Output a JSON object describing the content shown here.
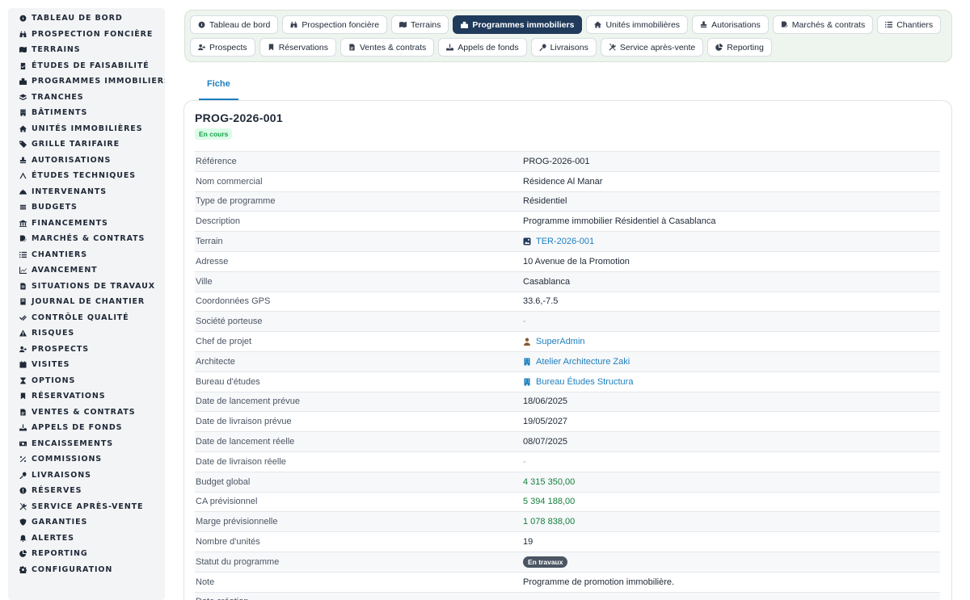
{
  "sidebar": {
    "items": [
      {
        "label": "Tableau de bord",
        "icon": "dashboard-icon"
      },
      {
        "label": "Prospection foncière",
        "icon": "binoculars-icon"
      },
      {
        "label": "Terrains",
        "icon": "map-icon"
      },
      {
        "label": "Études de faisabilité",
        "icon": "clipboard-check-icon"
      },
      {
        "label": "Programmes immobiliers",
        "icon": "city-icon"
      },
      {
        "label": "Tranches",
        "icon": "layers-icon"
      },
      {
        "label": "Bâtiments",
        "icon": "building-icon"
      },
      {
        "label": "Unités immobilières",
        "icon": "home-icon"
      },
      {
        "label": "Grille tarifaire",
        "icon": "tags-icon"
      },
      {
        "label": "Autorisations",
        "icon": "stamp-icon"
      },
      {
        "label": "Études techniques",
        "icon": "drafting-icon"
      },
      {
        "label": "Intervenants",
        "icon": "helmet-icon"
      },
      {
        "label": "Budgets",
        "icon": "coins-icon"
      },
      {
        "label": "Financements",
        "icon": "bank-icon"
      },
      {
        "label": "Marchés & contrats",
        "icon": "file-signature-icon"
      },
      {
        "label": "Chantiers",
        "icon": "list-icon"
      },
      {
        "label": "Avancement",
        "icon": "chart-line-icon"
      },
      {
        "label": "Situations de travaux",
        "icon": "file-invoice-icon"
      },
      {
        "label": "Journal de chantier",
        "icon": "journal-icon"
      },
      {
        "label": "Contrôle qualité",
        "icon": "check-double-icon"
      },
      {
        "label": "Risques",
        "icon": "warning-icon"
      },
      {
        "label": "Prospects",
        "icon": "user-plus-icon"
      },
      {
        "label": "Visites",
        "icon": "calendar-check-icon"
      },
      {
        "label": "Options",
        "icon": "hourglass-icon"
      },
      {
        "label": "Réservations",
        "icon": "bookmark-icon"
      },
      {
        "label": "Ventes & contrats",
        "icon": "file-contract-icon"
      },
      {
        "label": "Appels de fonds",
        "icon": "hand-holding-dollar-icon"
      },
      {
        "label": "Encaissements",
        "icon": "money-bill-icon"
      },
      {
        "label": "Commissions",
        "icon": "percent-icon"
      },
      {
        "label": "Livraisons",
        "icon": "key-icon"
      },
      {
        "label": "Réserves",
        "icon": "exclamation-circle-icon"
      },
      {
        "label": "Service après-vente",
        "icon": "tools-icon"
      },
      {
        "label": "Garanties",
        "icon": "shield-icon"
      },
      {
        "label": "Alertes",
        "icon": "bell-icon"
      },
      {
        "label": "Reporting",
        "icon": "chart-pie-icon"
      },
      {
        "label": "Configuration",
        "icon": "gear-icon"
      }
    ]
  },
  "modnav": {
    "items": [
      {
        "label": "Tableau de bord",
        "icon": "dashboard-icon",
        "active": false
      },
      {
        "label": "Prospection foncière",
        "icon": "binoculars-icon",
        "active": false
      },
      {
        "label": "Terrains",
        "icon": "map-icon",
        "active": false
      },
      {
        "label": "Programmes immobiliers",
        "icon": "city-icon",
        "active": true
      },
      {
        "label": "Unités immobilières",
        "icon": "home-icon",
        "active": false
      },
      {
        "label": "Autorisations",
        "icon": "stamp-icon",
        "active": false
      },
      {
        "label": "Marchés & contrats",
        "icon": "file-signature-icon",
        "active": false
      },
      {
        "label": "Chantiers",
        "icon": "list-icon",
        "active": false
      },
      {
        "label": "Prospects",
        "icon": "user-plus-icon",
        "active": false
      },
      {
        "label": "Réservations",
        "icon": "bookmark-icon",
        "active": false
      },
      {
        "label": "Ventes & contrats",
        "icon": "file-contract-icon",
        "active": false
      },
      {
        "label": "Appels de fonds",
        "icon": "hand-holding-dollar-icon",
        "active": false
      },
      {
        "label": "Livraisons",
        "icon": "key-icon",
        "active": false
      },
      {
        "label": "Service après-vente",
        "icon": "tools-icon",
        "active": false
      },
      {
        "label": "Reporting",
        "icon": "chart-pie-icon",
        "active": false
      }
    ]
  },
  "tabs": {
    "fiche": "Fiche"
  },
  "record": {
    "title": "PROG-2026-001",
    "status_badge": "En cours",
    "fields": [
      {
        "label": "Référence",
        "value": "PROG-2026-001",
        "kind": "text"
      },
      {
        "label": "Nom commercial",
        "value": "Résidence Al Manar",
        "kind": "text"
      },
      {
        "label": "Type de programme",
        "value": "Résidentiel",
        "kind": "text"
      },
      {
        "label": "Description",
        "value": "Programme immobilier Résidentiel à Casablanca",
        "kind": "text"
      },
      {
        "label": "Terrain",
        "value": "TER-2026-001",
        "kind": "link",
        "icon": "terrain-icon"
      },
      {
        "label": "Adresse",
        "value": "10 Avenue de la Promotion",
        "kind": "text"
      },
      {
        "label": "Ville",
        "value": "Casablanca",
        "kind": "text"
      },
      {
        "label": "Coordonnées GPS",
        "value": "33.6,-7.5",
        "kind": "text"
      },
      {
        "label": "Société porteuse",
        "value": "-",
        "kind": "dash"
      },
      {
        "label": "Chef de projet",
        "value": "SuperAdmin",
        "kind": "link",
        "icon": "user-icon"
      },
      {
        "label": "Architecte",
        "value": "Atelier Architecture Zaki",
        "kind": "link",
        "icon": "building-icon"
      },
      {
        "label": "Bureau d'études",
        "value": "Bureau Études Structura",
        "kind": "link",
        "icon": "building-icon"
      },
      {
        "label": "Date de lancement prévue",
        "value": "18/06/2025",
        "kind": "text"
      },
      {
        "label": "Date de livraison prévue",
        "value": "19/05/2027",
        "kind": "text"
      },
      {
        "label": "Date de lancement réelle",
        "value": "08/07/2025",
        "kind": "text"
      },
      {
        "label": "Date de livraison réelle",
        "value": "-",
        "kind": "dash"
      },
      {
        "label": "Budget global",
        "value": "4 315 350,00",
        "kind": "money"
      },
      {
        "label": "CA prévisionnel",
        "value": "5 394 188,00",
        "kind": "money"
      },
      {
        "label": "Marge prévisionnelle",
        "value": "1 078 838,00",
        "kind": "money"
      },
      {
        "label": "Nombre d'unités",
        "value": "19",
        "kind": "text"
      },
      {
        "label": "Statut du programme",
        "value": "En travaux",
        "kind": "badge"
      },
      {
        "label": "Note",
        "value": "Programme de promotion immobilière.",
        "kind": "text"
      },
      {
        "label": "Date création",
        "value": "",
        "kind": "text"
      }
    ]
  },
  "colors": {
    "active_nav": "#1f3a5a",
    "link": "#1d7fbf",
    "money": "#15803d",
    "status_green": "#16a34a"
  }
}
